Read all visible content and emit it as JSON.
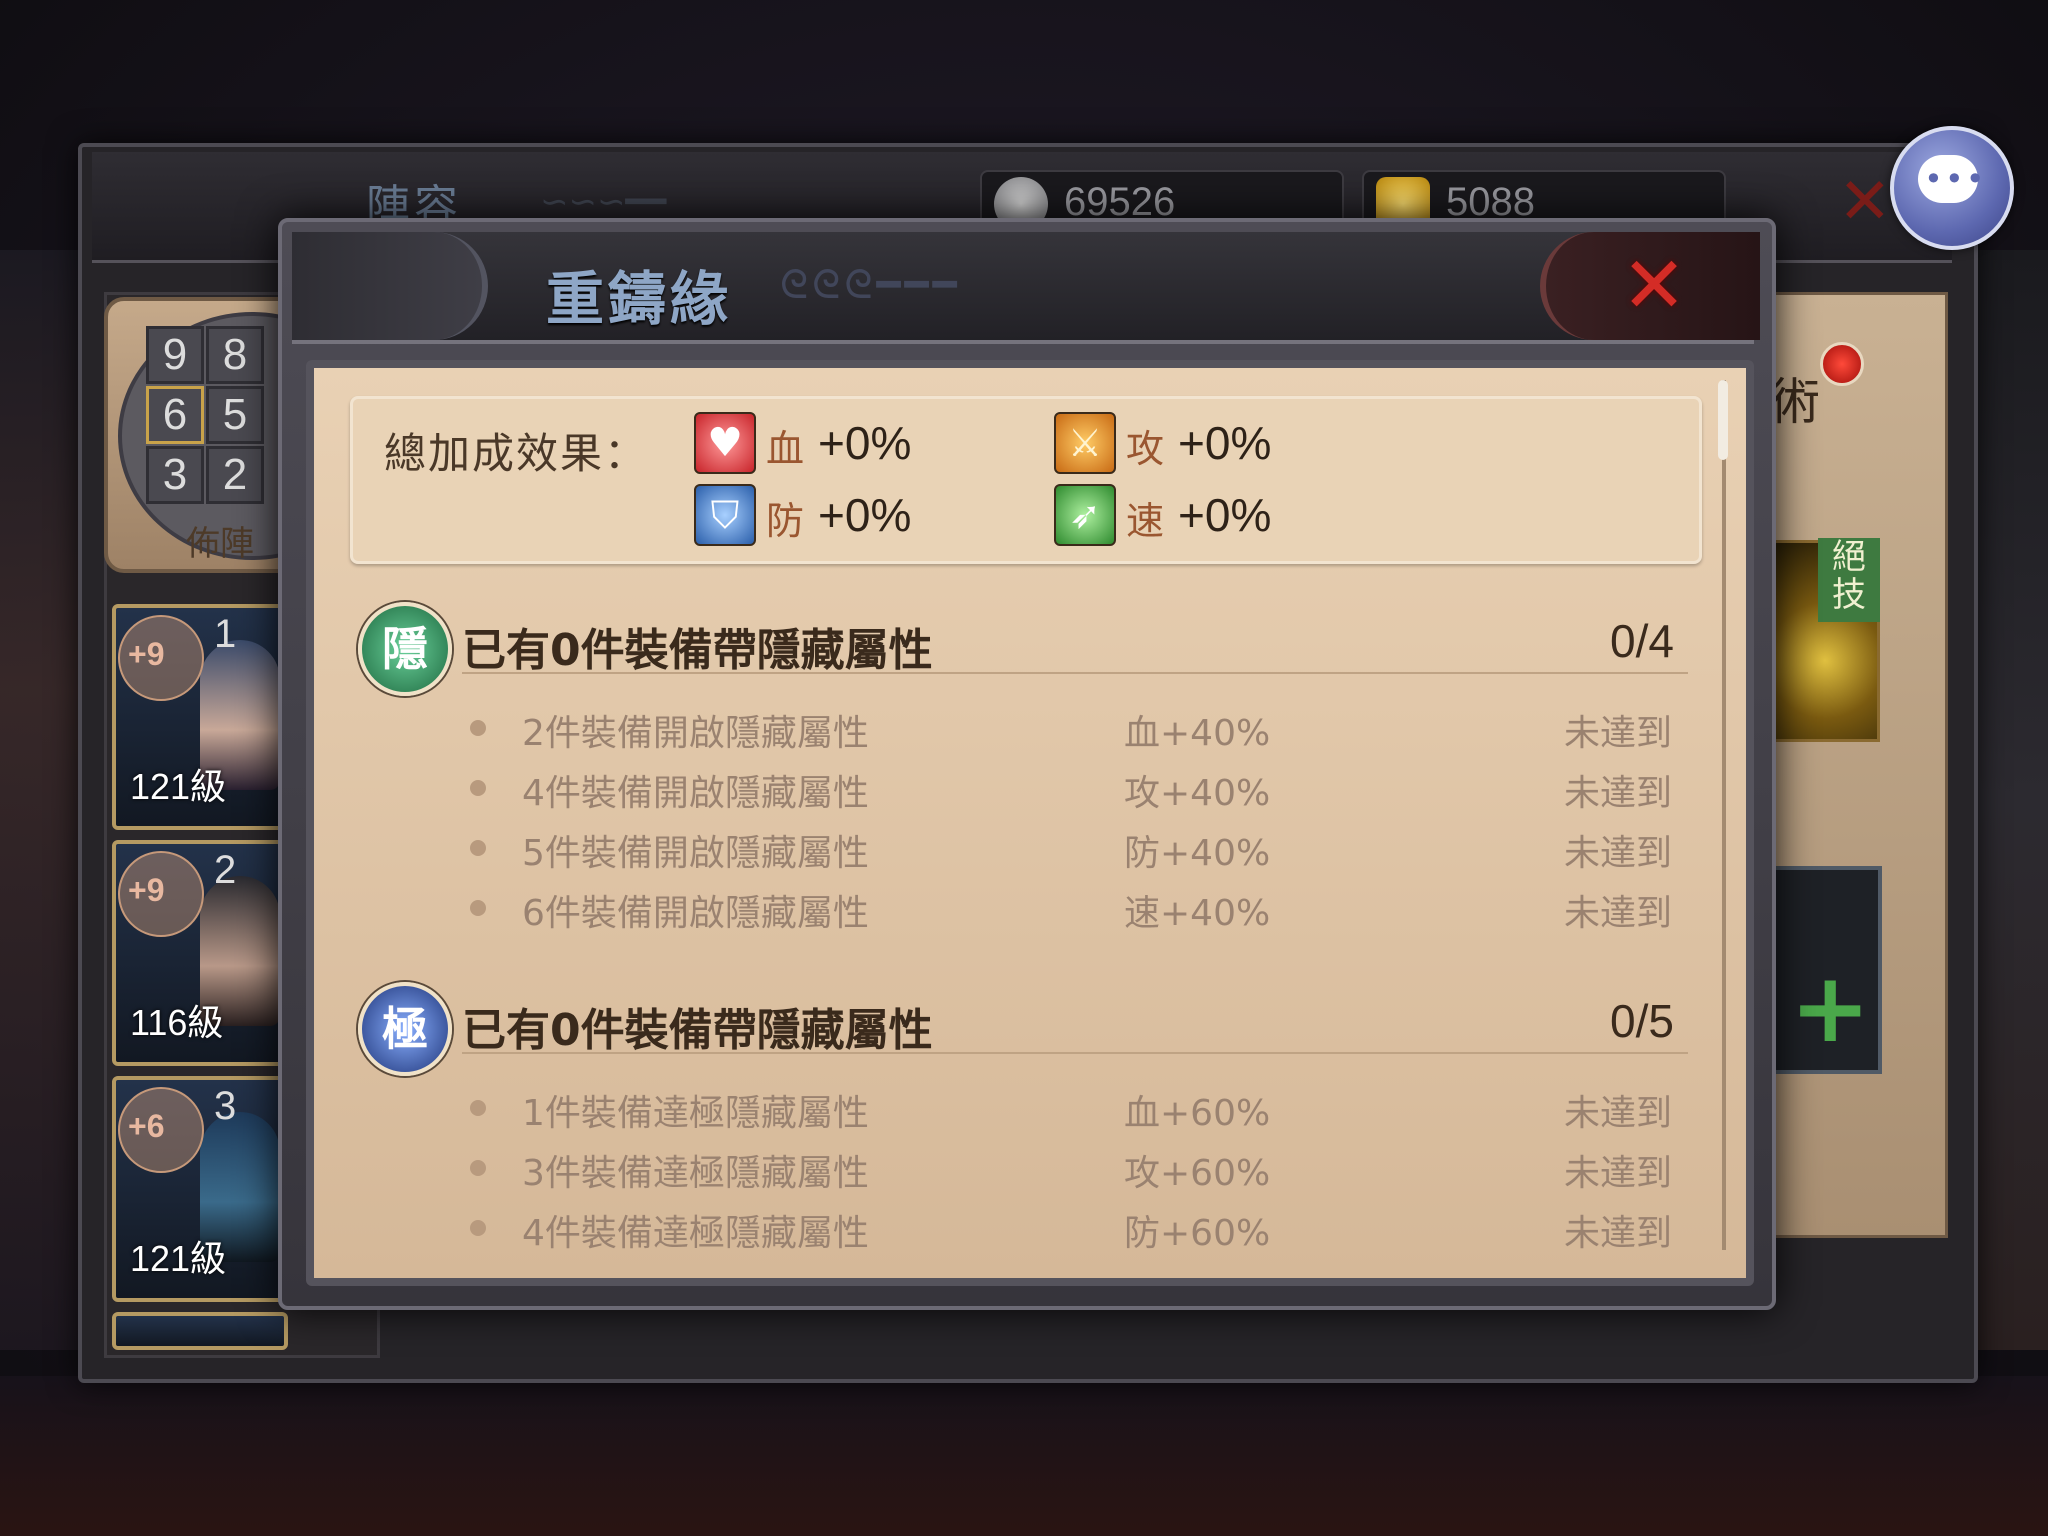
{
  "outer": {
    "title": "陣容",
    "silver": "69526",
    "gold": "5088",
    "formation_label": "佈陣",
    "formation_cells": [
      "9",
      "8",
      "6",
      "5",
      "3",
      "2"
    ],
    "heroes": [
      {
        "level": "121級",
        "plus": "+9",
        "slot": "1"
      },
      {
        "level": "116級",
        "plus": "+9",
        "slot": "2"
      },
      {
        "level": "121級",
        "plus": "+6",
        "slot": "3"
      }
    ],
    "right_tab": "術",
    "skill_tag": "絕技"
  },
  "dialog": {
    "title": "重鑄緣",
    "summary_label": "總加成效果：",
    "stats": [
      {
        "name": "血",
        "value": "+0%",
        "icon": "heart-icon",
        "color": "#d8343a"
      },
      {
        "name": "攻",
        "value": "+0%",
        "icon": "sword-icon",
        "color": "#d87a1a"
      },
      {
        "name": "防",
        "value": "+0%",
        "icon": "shield-icon",
        "color": "#2f6fb8"
      },
      {
        "name": "速",
        "value": "+0%",
        "icon": "boot-icon",
        "color": "#3aa03a"
      }
    ],
    "sections": [
      {
        "badge": "隱",
        "badge_color": "#2e8a5a",
        "title": "已有0件裝備帶隱藏屬性",
        "count": "0/4",
        "rows": [
          {
            "desc": "2件裝備開啟隱藏屬性",
            "bonus": "血+40%",
            "status": "未達到"
          },
          {
            "desc": "4件裝備開啟隱藏屬性",
            "bonus": "攻+40%",
            "status": "未達到"
          },
          {
            "desc": "5件裝備開啟隱藏屬性",
            "bonus": "防+40%",
            "status": "未達到"
          },
          {
            "desc": "6件裝備開啟隱藏屬性",
            "bonus": "速+40%",
            "status": "未達到"
          }
        ]
      },
      {
        "badge": "極",
        "badge_color": "#2a4a9a",
        "title": "已有0件裝備帶隱藏屬性",
        "count": "0/5",
        "rows": [
          {
            "desc": "1件裝備達極隱藏屬性",
            "bonus": "血+60%",
            "status": "未達到"
          },
          {
            "desc": "3件裝備達極隱藏屬性",
            "bonus": "攻+60%",
            "status": "未達到"
          },
          {
            "desc": "4件裝備達極隱藏屬性",
            "bonus": "防+60%",
            "status": "未達到"
          }
        ]
      }
    ]
  }
}
